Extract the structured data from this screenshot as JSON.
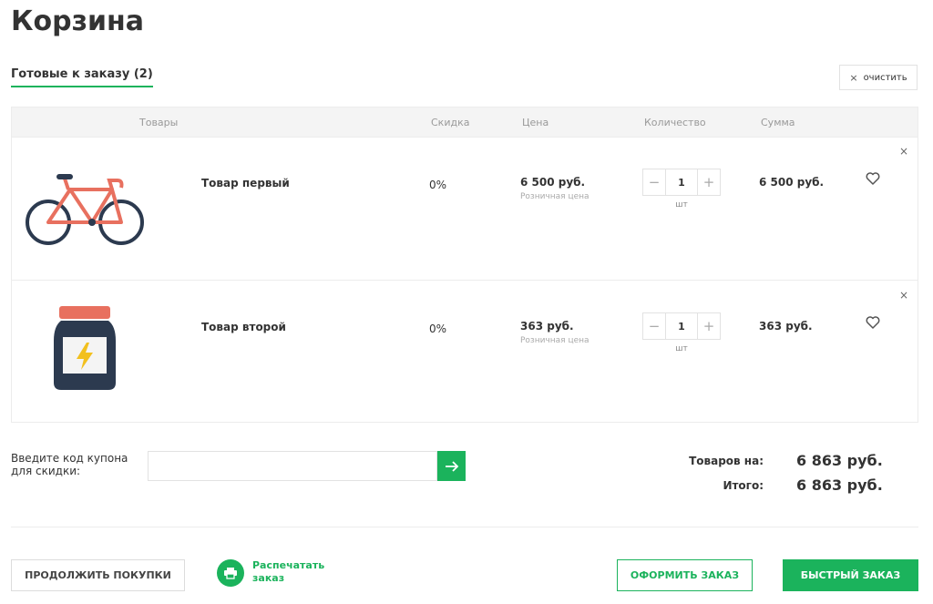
{
  "page": {
    "title": "Корзина"
  },
  "tabs": {
    "ready": "Готовые к заказу (2)"
  },
  "actions": {
    "clear_label": "очистить",
    "clear_icon": "close-icon"
  },
  "table": {
    "headers": [
      "Товары",
      "Скидка",
      "Цена",
      "Количество",
      "Сумма"
    ],
    "rows": [
      {
        "name": "Товар первый",
        "discount": "0%",
        "price": "6 500 руб.",
        "price_note": "Розничная цена",
        "qty": "1",
        "unit": "шт",
        "sum": "6 500 руб.",
        "image": "bicycle-image"
      },
      {
        "name": "Товар второй",
        "discount": "0%",
        "price": "363 руб.",
        "price_note": "Розничная цена",
        "qty": "1",
        "unit": "шт",
        "sum": "363 руб.",
        "image": "jar-image"
      }
    ]
  },
  "coupon": {
    "label": "Введите код купона для скидки:",
    "value": "",
    "placeholder": ""
  },
  "summary": {
    "goods_label": "Товаров на:",
    "goods_value": "6 863 руб.",
    "total_label": "Итого:",
    "total_value": "6 863 руб."
  },
  "buttons": {
    "continue": "ПРОДОЛЖИТЬ ПОКУПКИ",
    "print": "Распечатать заказ",
    "checkout": "ОФОРМИТЬ ЗАКАЗ",
    "quick": "БЫСТРЫЙ ЗАКАЗ"
  },
  "colors": {
    "accent": "#1bb35c",
    "bike": "#e8705f",
    "dark": "#2c3a4f",
    "bolt": "#f2c01e"
  }
}
